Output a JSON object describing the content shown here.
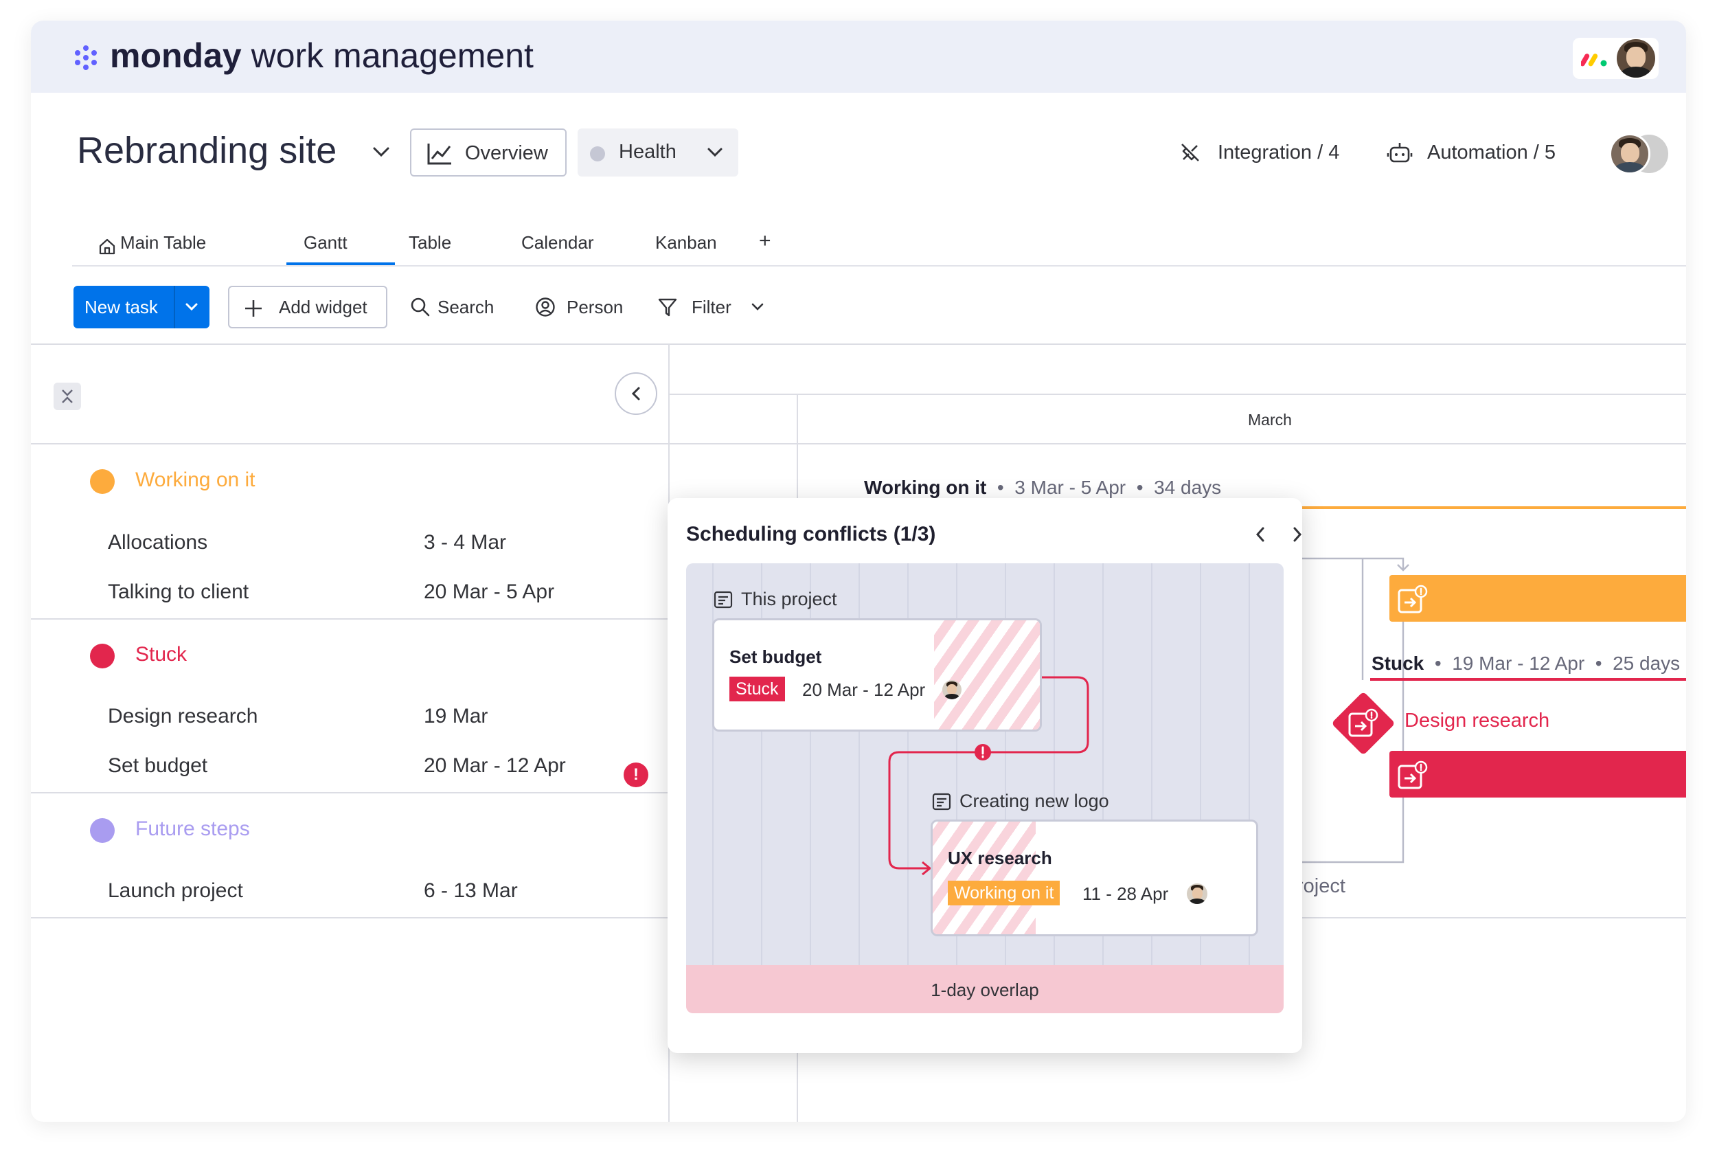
{
  "brand": {
    "name_bold": "monday",
    "name_rest": " work management"
  },
  "board": {
    "title": "Rebranding site",
    "overview_label": "Overview",
    "health_label": "Health",
    "integration_label": "Integration / 4",
    "automation_label": "Automation / 5"
  },
  "tabs": [
    {
      "label": "Main Table"
    },
    {
      "label": "Gantt"
    },
    {
      "label": "Table"
    },
    {
      "label": "Calendar"
    },
    {
      "label": "Kanban"
    },
    {
      "label": "+"
    }
  ],
  "toolbar": {
    "new_task": "New task",
    "add_widget": "Add widget",
    "search": "Search",
    "person": "Person",
    "filter": "Filter"
  },
  "groups": [
    {
      "title": "Working on it",
      "color": "#fdab3d",
      "rows": [
        {
          "name": "Allocations",
          "date": "3 - 4 Mar"
        },
        {
          "name": "Talking to client",
          "date": "20 Mar - 5 Apr"
        }
      ]
    },
    {
      "title": "Stuck",
      "color": "#e2264d",
      "rows": [
        {
          "name": "Design research",
          "date": "19 Mar"
        },
        {
          "name": "Set budget",
          "date": "20 Mar - 12 Apr"
        }
      ]
    },
    {
      "title": "Future steps",
      "color": "#a99cf0",
      "rows": [
        {
          "name": "Launch project",
          "date": "6 - 13 Mar"
        }
      ]
    }
  ],
  "alert_glyph": "!",
  "gantt": {
    "month": "March",
    "working_summary": {
      "label": "Working on it",
      "range": "3 Mar - 5 Apr",
      "days": "34 days"
    },
    "stuck_summary": {
      "label": "Stuck",
      "range": "19 Mar - 12 Apr",
      "days": "25 days"
    },
    "design_research": "Design research",
    "project_fragment": "roject"
  },
  "popup": {
    "title": "Scheduling conflicts (1/3)",
    "section_this_project": "This project",
    "card1": {
      "name": "Set budget",
      "status": "Stuck",
      "status_color": "#e2264d",
      "date": "20 Mar - 12 Apr"
    },
    "section_other_project": "Creating new logo",
    "card2": {
      "name": "UX research",
      "status": "Working on it",
      "status_color": "#fdab3d",
      "date": "11 - 28 Apr"
    },
    "overlap": "1-day overlap"
  },
  "separator": "•"
}
